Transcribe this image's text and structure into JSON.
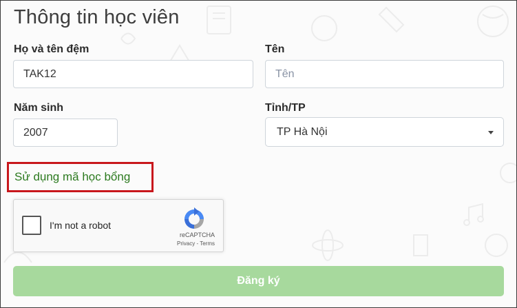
{
  "form": {
    "title": "Thông tin học viên",
    "fields": {
      "middle_name": {
        "label": "Họ và tên đệm",
        "value": "TAK12"
      },
      "first_name": {
        "label": "Tên",
        "placeholder": "Tên",
        "value": ""
      },
      "birth_year": {
        "label": "Năm sinh",
        "value": "2007"
      },
      "province": {
        "label": "Tỉnh/TP",
        "selected": "TP Hà Nội"
      }
    },
    "scholarship_link": "Sử dụng mã học bổng",
    "captcha": {
      "label": "I'm not a robot",
      "brand": "reCAPTCHA",
      "privacy": "Privacy",
      "separator": " - ",
      "terms": "Terms"
    },
    "submit_label": "Đăng ký"
  },
  "colors": {
    "link_green": "#2c7a1f",
    "highlight_red": "#c8171c",
    "button_green": "#a7d99d"
  },
  "icons": [
    "recaptcha-logo-icon",
    "dropdown-caret-icon"
  ]
}
